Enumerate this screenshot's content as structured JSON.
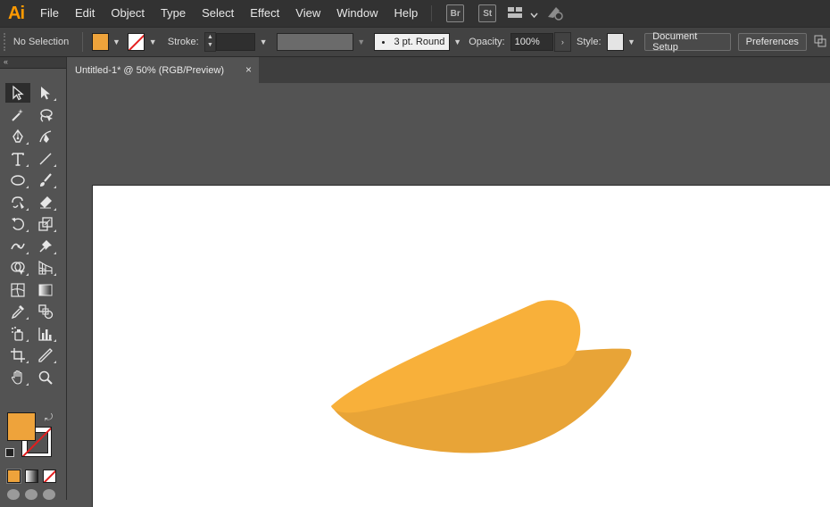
{
  "app": {
    "logo": "Ai"
  },
  "menu": [
    "File",
    "Edit",
    "Object",
    "Type",
    "Select",
    "Effect",
    "View",
    "Window",
    "Help"
  ],
  "app_icons": [
    "Br",
    "St"
  ],
  "control_bar": {
    "selection": "No Selection",
    "stroke_label": "Stroke:",
    "brush": "3 pt. Round",
    "opacity_label": "Opacity:",
    "opacity_value": "100%",
    "style_label": "Style:",
    "document_setup": "Document Setup",
    "preferences": "Preferences"
  },
  "document": {
    "tab_title": "Untitled-1* @ 50% (RGB/Preview)",
    "close_glyph": "×"
  },
  "colors": {
    "fill": "#eea33b",
    "shape_front": "#f8b03a",
    "shape_back": "#e8a437",
    "stroke_none": "#e41e1e"
  },
  "tools": [
    [
      "selection-tool-icon",
      "direct-selection-tool-icon"
    ],
    [
      "magic-wand-tool-icon",
      "lasso-tool-icon"
    ],
    [
      "pen-tool-icon",
      "curvature-tool-icon"
    ],
    [
      "type-tool-icon",
      "line-segment-tool-icon"
    ],
    [
      "ellipse-tool-icon",
      "paintbrush-tool-icon"
    ],
    [
      "shaper-tool-icon",
      "eraser-tool-icon"
    ],
    [
      "rotate-tool-icon",
      "scale-tool-icon"
    ],
    [
      "width-tool-icon",
      "puppet-warp-tool-icon"
    ],
    [
      "shape-builder-tool-icon",
      "perspective-grid-tool-icon"
    ],
    [
      "mesh-tool-icon",
      "gradient-tool-icon"
    ],
    [
      "eyedropper-tool-icon",
      "blend-tool-icon"
    ],
    [
      "symbol-sprayer-tool-icon",
      "column-graph-tool-icon"
    ],
    [
      "artboard-tool-icon",
      "slice-tool-icon"
    ],
    [
      "hand-tool-icon",
      "zoom-tool-icon"
    ]
  ]
}
